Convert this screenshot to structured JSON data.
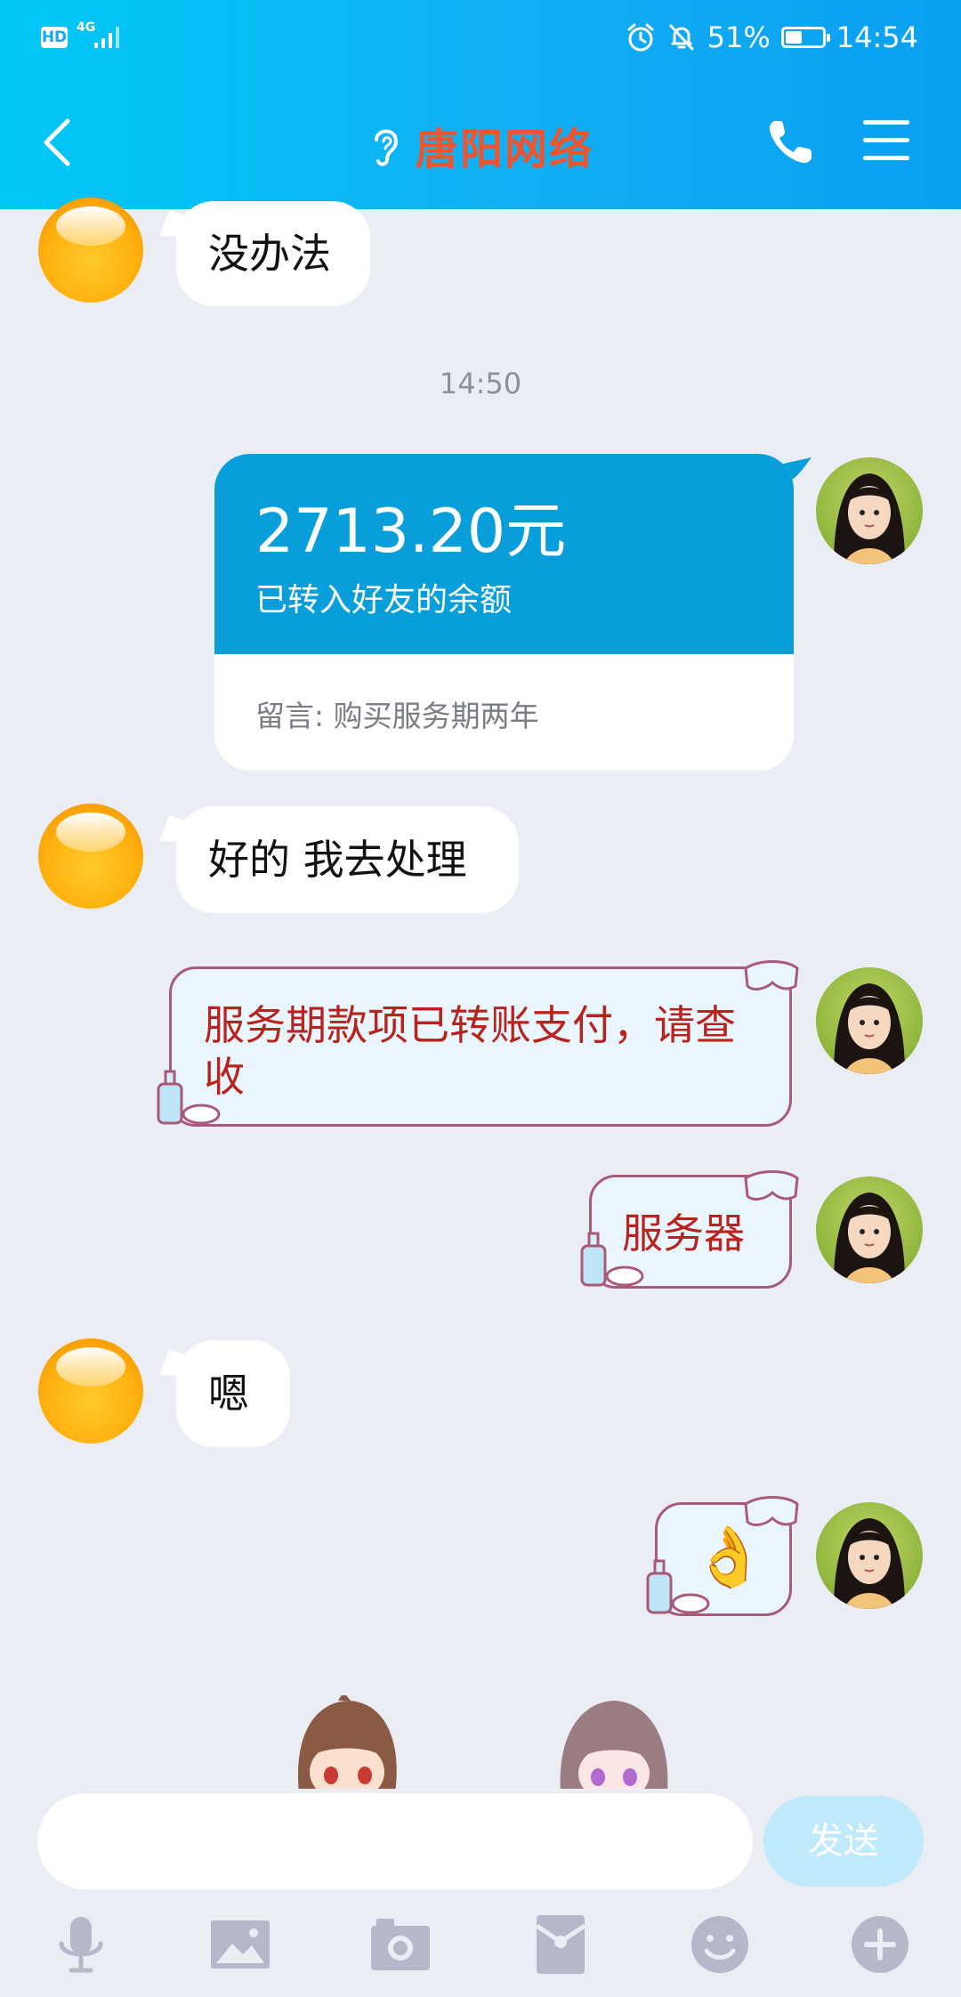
{
  "status_bar": {
    "hd": "HD",
    "network": "4G",
    "battery_percent": "51%",
    "battery_level": 0.51,
    "time": "14:54"
  },
  "header": {
    "title": "唐阳网络"
  },
  "messages": [
    {
      "type": "text",
      "side": "left",
      "text": "没办法"
    },
    {
      "type": "time",
      "text": "14:50"
    },
    {
      "type": "transfer",
      "side": "right",
      "amount": "2713.20元",
      "desc": "已转入好友的余额",
      "note": "留言: 购买服务期两年"
    },
    {
      "type": "text",
      "side": "left",
      "text": "好的 我去处理"
    },
    {
      "type": "text-deco",
      "side": "right",
      "text": "服务期款项已转账支付，请查收"
    },
    {
      "type": "text-deco",
      "side": "right",
      "text": "服务器"
    },
    {
      "type": "text",
      "side": "left",
      "text": "嗯"
    },
    {
      "type": "emoji-deco",
      "side": "right",
      "text": "👌"
    }
  ],
  "composer": {
    "input_value": "",
    "send_label": "发送"
  },
  "toolbar": [
    "microphone-icon",
    "image-icon",
    "camera-icon",
    "red-packet-icon",
    "emoji-icon",
    "plus-icon"
  ],
  "colors": {
    "header_gradient_start": "#00c8f6",
    "header_gradient_end": "#0aa0f2",
    "title": "#f1532b",
    "transfer_blue": "#079ed9",
    "deco_text": "#b8231c",
    "background": "#ebedf5"
  }
}
